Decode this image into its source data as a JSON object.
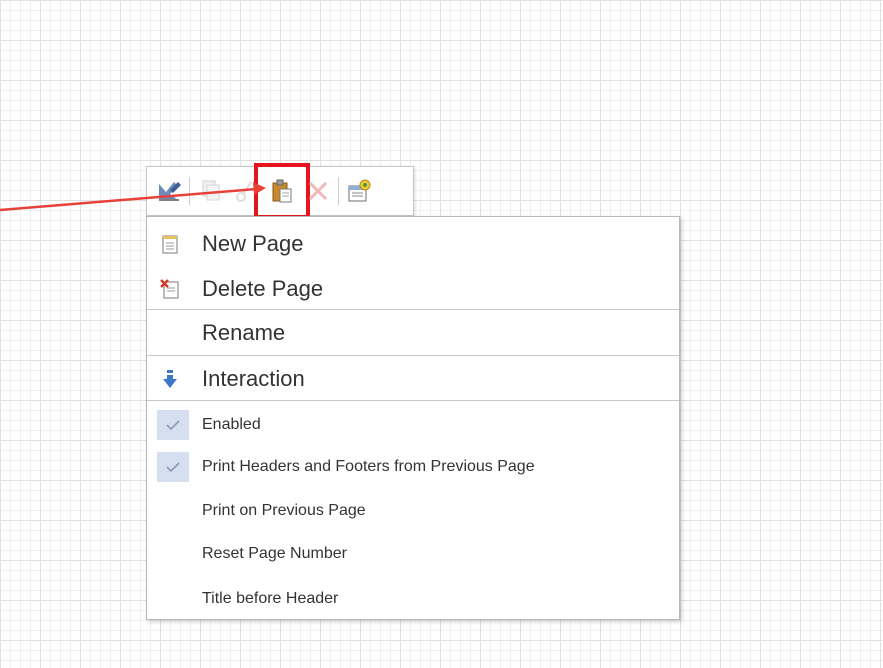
{
  "toolbar": {
    "buttons": [
      {
        "icon": "edit-pencil-icon",
        "enabled": true
      },
      {
        "icon": "copy-icon",
        "enabled": false
      },
      {
        "icon": "cut-icon",
        "enabled": false
      },
      {
        "icon": "paste-icon",
        "enabled": true,
        "highlighted": true
      },
      {
        "icon": "delete-icon",
        "enabled": false
      },
      {
        "icon": "properties-icon",
        "enabled": true
      }
    ]
  },
  "menu": {
    "items": [
      {
        "label": "New Page",
        "icon": "new-page-icon"
      },
      {
        "label": "Delete Page",
        "icon": "delete-page-icon"
      },
      {
        "label": "Rename"
      },
      {
        "label": "Interaction",
        "icon": "arrow-down-icon"
      },
      {
        "label": "Enabled",
        "checked": true
      },
      {
        "label": "Print Headers and Footers from Previous Page",
        "checked": true
      },
      {
        "label": "Print on Previous Page",
        "checked": false
      },
      {
        "label": "Reset Page Number",
        "checked": false
      },
      {
        "label": "Title before Header",
        "checked": false
      }
    ]
  },
  "colors": {
    "highlight": "#e8141c",
    "arrow": "#e8413a",
    "check_bg": "#d5dff0",
    "grid": "#e0e0e0"
  }
}
